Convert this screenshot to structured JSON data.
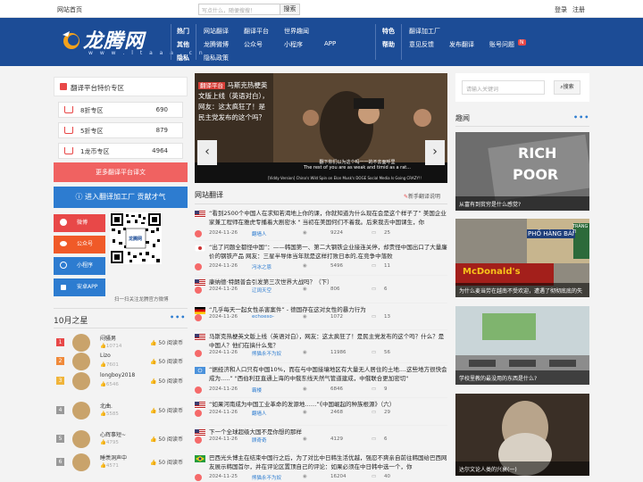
{
  "topbar": {
    "home": "网站首页",
    "search_placeholder": "写点什么，随便搜搜！",
    "search_btn": "搜索",
    "login": "登录",
    "register": "注册"
  },
  "logo": {
    "text": "龙腾网",
    "url": "w w w . l t a a a . c n"
  },
  "nav": {
    "col1": [
      "热门",
      "其他",
      "隐私"
    ],
    "row1": [
      "网站翻译",
      "翻译平台",
      "世界趣闻"
    ],
    "row2": [
      "龙腾微博",
      "公众号",
      "小程序",
      "APP"
    ],
    "row3": [
      "隐私政策"
    ],
    "col2": [
      "特色",
      "帮助"
    ],
    "r2a": [
      "翻译加工厂"
    ],
    "r2b": [
      "意见反馈",
      "发布翻译",
      "账号问题"
    ],
    "badge": "N"
  },
  "promo": {
    "title": "翻译平台特价专区",
    "rows": [
      {
        "label": "8折专区",
        "value": "690"
      },
      {
        "label": "5折专区",
        "value": "879"
      },
      {
        "label": "1龙币专区",
        "value": "4964"
      }
    ],
    "more": "更多翻译平台译文",
    "join": "进入翻译加工厂 贡献才气"
  },
  "social": [
    "微博",
    "公众号",
    "小程序",
    "安卓APP"
  ],
  "qr": {
    "caption": "扫一扫关注龙腾官方微博",
    "label": "龙腾网"
  },
  "stars": {
    "title": "10月之星",
    "items": [
      {
        "rank": "1",
        "name": "闷骚男",
        "score": "10714",
        "likes": "50 阅读币"
      },
      {
        "rank": "2",
        "name": "Lizo",
        "score": "7601",
        "likes": "50 阅读币"
      },
      {
        "rank": "3",
        "name": "longboy2018",
        "score": "6546",
        "likes": "50 阅读币"
      },
      {
        "rank": "4",
        "name": "北曲.",
        "score": "5585",
        "likes": "50 阅读币"
      },
      {
        "rank": "5",
        "name": "心辉事短~",
        "score": "4795",
        "likes": "50 阅读币"
      },
      {
        "rank": "6",
        "name": "睡羡洞声中",
        "score": "4571",
        "likes": "50 阅读币"
      }
    ],
    "colors": [
      "#e84848",
      "#f08a3a",
      "#f0b43a",
      "#999999",
      "#999999",
      "#999999"
    ]
  },
  "slider": {
    "tag": "翻译平台",
    "caption": "马斯克热梗英文版上线（英语对白），网友：这太疯狂了！是民主党发布的这个吗？",
    "subtitle1": "翻下你们以为这个吗一一的不去面呼里",
    "subtitle2": "The rest of you are as weak and timid as a rat...",
    "bottom": "[Viddy Version] China's Wild Spin on Elon Musk's DOGE Social Media Is Going CRAZY!!"
  },
  "feed": {
    "title": "网站翻译",
    "more": "新手翻译说明",
    "items": [
      {
        "flag": "us",
        "title": "“看到2500个中国人在求知若渴地上你的课，你就知道为什么现在会是这个样子了” 美国企业家兼工程师在雅虎专播着大剧密水 \" 当初在美国何们不着我。后来我去中国课生，你",
        "date": "2024-11-26",
        "user": "翻墙人",
        "views": "9224",
        "comments": "25"
      },
      {
        "flag": "kr",
        "title": "“出了问题全都怪中国”：——韩国第一、第二大钢铁企业接连关停，却责怪中国出口了大量廉价的钢铁产品 网友：三星半导体当年就是这样打败日本的,在竞争中落败",
        "date": "2024-11-26",
        "user": "冯冰之恩",
        "views": "5496",
        "comments": "11"
      },
      {
        "flag": "us",
        "title": "康纳德·特朗普会引发第三次世界大战吗？（下）",
        "date": "2024-11-26",
        "user": "辽阔天空",
        "views": "806",
        "comments": "6"
      },
      {
        "flag": "de",
        "title": "“几乎每天一起女性杀害案件” - 德国存在这对女性的暴力行为",
        "date": "2024-11-26",
        "user": "echoeso-",
        "views": "1072",
        "comments": "13"
      },
      {
        "flag": "us",
        "title": "马斯克热梗英文版上线（英语对白），网友：这太疯狂了！是民主党发布的这个吗？什么？是中国人？他们在搞什么鬼？",
        "date": "2024-11-26",
        "user": "熊猫永不为奴",
        "views": "11986",
        "comments": "56"
      },
      {
        "flag": "un",
        "title": "“据经济和人口只有中国10%，而在与中国接壤地区有大量无人居住的土地....这些地方很快会成为.....” \"西伯利亚直通上海的中俄东线天然气管道建成，中俄联合更加密切\"",
        "date": "2024-11-26",
        "user": "霸楼",
        "views": "6846",
        "comments": "9"
      },
      {
        "flag": "us",
        "title": "“如果河南成为中国工业革命的发源地……”《中国崛起的种族根源》（六）",
        "date": "2024-11-26",
        "user": "翻墙人",
        "views": "2468",
        "comments": "29"
      },
      {
        "flag": "us",
        "title": "下一个全球超级大国不是你想的那样",
        "date": "2024-11-26",
        "user": "顾奇奇",
        "views": "4129",
        "comments": "6"
      },
      {
        "flag": "br",
        "title": "巴西光头博主在结束中国行之后，为了对比中日韩生活优越，强忍不爽亲自前往韩国给巴西网友展示韩国首尔，并在评论区置顶自己的评论：如果必须在中日韩中选一个，你",
        "date": "2024-11-25",
        "user": "熊猫永不为奴",
        "views": "16204",
        "comments": "40"
      }
    ]
  },
  "side": {
    "search_placeholder": "请输入关键词",
    "search_btn": "搜索",
    "title": "趣闻",
    "items": [
      {
        "caption": "从富有到贫穷是什么感觉?",
        "word1": "RICH",
        "word2": "POOR"
      },
      {
        "caption": "为什么麦当劳在越南不受欢迎，遭遇了彻彻底底的失",
        "sign": "McDonald's",
        "street": "PHỐ HÀNG BÀI",
        "street2": "TRÀNG TI"
      },
      {
        "caption": "学校里教的最没用的东西是什么?"
      },
      {
        "caption": "达尔文论人类的兴衰(一)"
      }
    ]
  }
}
